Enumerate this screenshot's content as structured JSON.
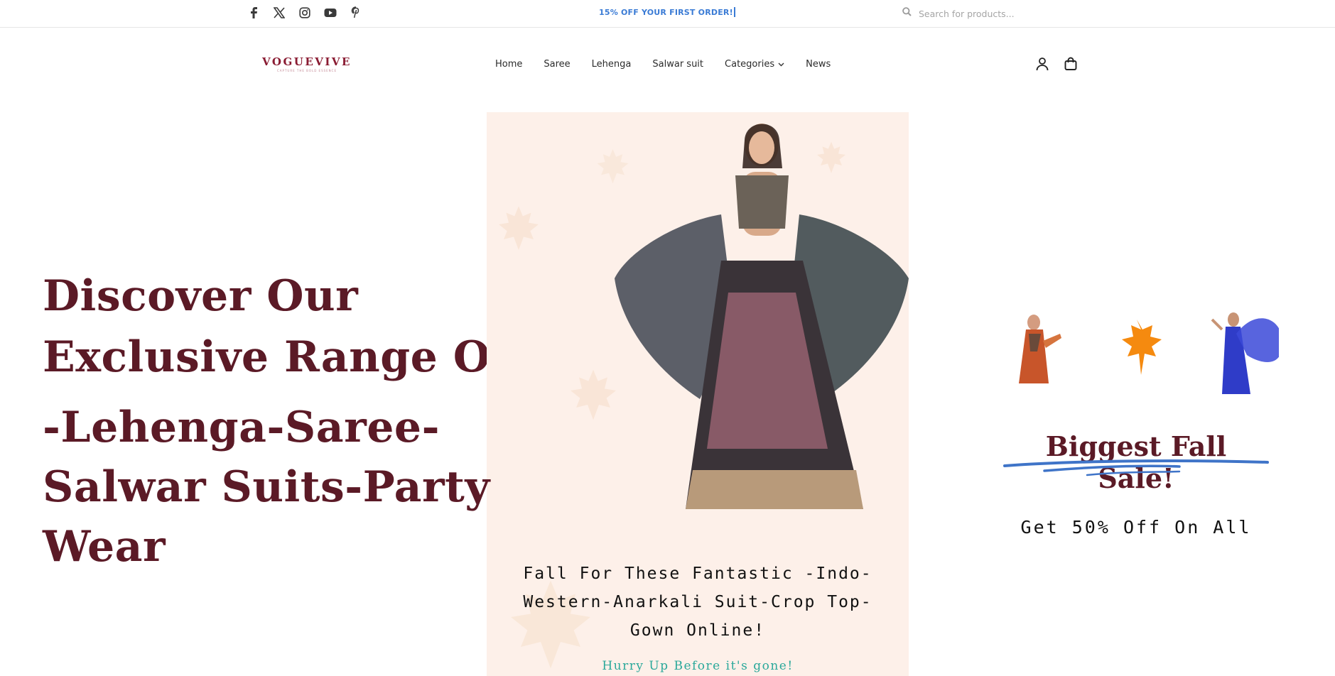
{
  "topbar": {
    "social": [
      {
        "icon": "facebook-icon"
      },
      {
        "icon": "x-twitter-icon"
      },
      {
        "icon": "instagram-icon"
      },
      {
        "icon": "youtube-icon"
      },
      {
        "icon": "pinterest-icon"
      }
    ],
    "promo": "15% OFF YOUR FIRST ORDER!",
    "search_placeholder": "Search for products..."
  },
  "header": {
    "logo_name": "VOGUEVIVE",
    "logo_tagline": "CAPTURE THE BOLD ESSENCE",
    "nav": [
      "Home",
      "Saree",
      "Lehenga",
      "Salwar suit",
      "Categories",
      "News"
    ],
    "icons": [
      "account-icon",
      "shopping-bag-icon"
    ]
  },
  "hero": {
    "headline_1": "Discover Our Exclusive Range Of",
    "headline_2": "-Lehenga-Saree-Salwar Suits-Party Wear",
    "panel_title": "Fall For These Fantastic -Indo-Western-Anarkali Suit-Crop Top-Gown Online!",
    "panel_subtitle": "Hurry Up Before it's gone!",
    "sale_title": "Biggest Fall Sale!",
    "sale_offer": "Get 50% Off On All"
  },
  "colors": {
    "brand": "#5b1a26",
    "logo": "#8a1c33",
    "promo": "#3a7bd5",
    "panel_bg": "#fdf0e9",
    "accent_teal": "#2aa89a",
    "leaf_orange": "#f58a0f"
  }
}
